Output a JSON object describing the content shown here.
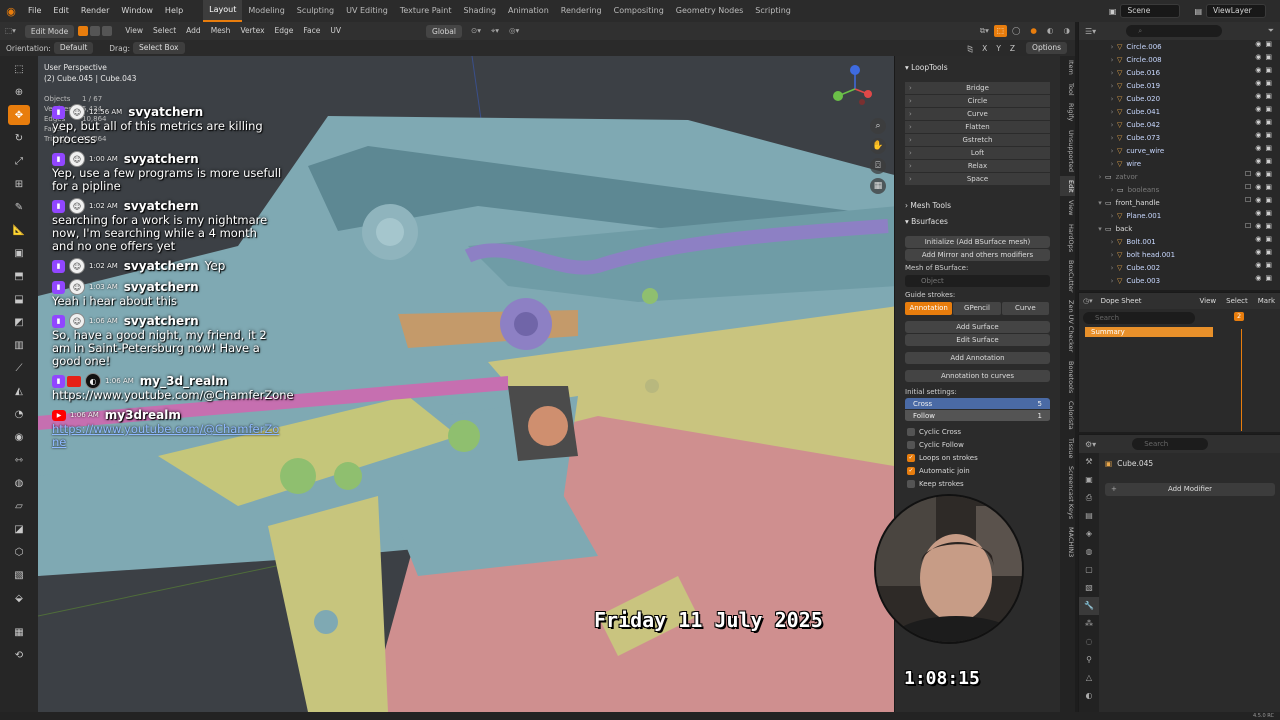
{
  "menu": [
    "File",
    "Edit",
    "Render",
    "Window",
    "Help"
  ],
  "workspaces": [
    "Layout",
    "Modeling",
    "Sculpting",
    "UV Editing",
    "Texture Paint",
    "Shading",
    "Animation",
    "Rendering",
    "Compositing",
    "Geometry Nodes",
    "Scripting"
  ],
  "active_workspace": "Layout",
  "scene_name": "Scene",
  "view_layer": "ViewLayer",
  "header": {
    "mode": "Edit Mode",
    "menus": [
      "View",
      "Select",
      "Add",
      "Mesh",
      "Vertex",
      "Edge",
      "Face",
      "UV"
    ],
    "transform": "Global",
    "options": "Options",
    "xyz": [
      "X",
      "Y",
      "Z"
    ]
  },
  "header3": {
    "orientation_label": "Orientation:",
    "orientation_value": "Default",
    "drag_label": "Drag:",
    "drag_value": "Select Box"
  },
  "viewport": {
    "view_name": "User Perspective",
    "object_name": "(2) Cube.045 | Cube.043",
    "stats": [
      {
        "label": "Objects",
        "value": "1 / 67"
      },
      {
        "label": "Vertices",
        "value": "5,434"
      },
      {
        "label": "Edges",
        "value": "10,864"
      },
      {
        "label": "Faces",
        "value": ""
      },
      {
        "label": "Triangles",
        "value": "10,864"
      }
    ]
  },
  "chat": [
    {
      "badge": "twitch",
      "time": "12:56 AM",
      "user": "svyatchern",
      "inline": "",
      "text": "yep, but all of this metrics are killing process"
    },
    {
      "badge": "twitch",
      "time": "1:00 AM",
      "user": "svyatchern",
      "inline": "",
      "text": "Yep, use a few programs is more usefull for a pipline"
    },
    {
      "badge": "twitch",
      "time": "1:02 AM",
      "user": "svyatchern",
      "inline": "",
      "text": "searching for a work is my nightmare now, I'm searching while a 4 month and no one offers yet"
    },
    {
      "badge": "twitch",
      "time": "1:02 AM",
      "user": "svyatchern",
      "inline": "Yep",
      "text": ""
    },
    {
      "badge": "twitch",
      "time": "1:03 AM",
      "user": "svyatchern",
      "inline": "",
      "text": "Yeah i hear about this"
    },
    {
      "badge": "twitch",
      "time": "1:06 AM",
      "user": "svyatchern",
      "inline": "",
      "text": "So, have a good night, my friend, it 2 am in Saint-Petersburg now! Have a good one!"
    },
    {
      "badge": "twitch",
      "time": "1:06 AM",
      "user": "my_3d_realm",
      "inline": "",
      "text": "https://www.youtube.com/@ChamferZone"
    },
    {
      "badge": "youtube",
      "time": "1:06 AM",
      "user": "my3drealm",
      "inline": "",
      "link": "https://www.youtube.com/@ChamferZone"
    }
  ],
  "overlay": {
    "date": "Friday 11 July 2025",
    "timer": "1:08:15"
  },
  "npanel": {
    "looptools_title": "LoopTools",
    "looptools": [
      "Bridge",
      "Circle",
      "Curve",
      "Flatten",
      "Gstretch",
      "Loft",
      "Relax",
      "Space"
    ],
    "mesh_tools": "Mesh Tools",
    "bsurfaces": "Bsurfaces",
    "init_btn": "Initialize (Add BSurface mesh)",
    "mirror_btn": "Add Mirror and others modifiers",
    "mesh_label": "Mesh of BSurface:",
    "mesh_field": "Object",
    "guide_label": "Guide strokes:",
    "guide_tabs": [
      "Annotation",
      "GPencil",
      "Curve"
    ],
    "add_surface": "Add Surface",
    "edit_surface": "Edit Surface",
    "add_annotation": "Add Annotation",
    "annotation_curves": "Annotation to curves",
    "initial_label": "Initial settings:",
    "cross_label": "Cross",
    "cross_value": "5",
    "follow_label": "Follow",
    "follow_value": "1",
    "checks": [
      {
        "label": "Cyclic Cross",
        "on": false
      },
      {
        "label": "Cyclic Follow",
        "on": false
      },
      {
        "label": "Loops on strokes",
        "on": true
      },
      {
        "label": "Automatic join",
        "on": true
      },
      {
        "label": "Keep strokes",
        "on": false
      }
    ]
  },
  "vtabs": [
    "Item",
    "Tool",
    "Rigify",
    "Unsupported",
    "Edit",
    "View",
    "HardOps",
    "BoxCutter",
    "Zen UV Checker",
    "Bonetools",
    "Colorista",
    "Tissue",
    "Screencast Keys",
    "MACHIN3"
  ],
  "outliner": {
    "rows": [
      {
        "name": "Circle.006",
        "type": "obj",
        "indent": 2
      },
      {
        "name": "Circle.008",
        "type": "obj",
        "indent": 2
      },
      {
        "name": "Cube.016",
        "type": "obj",
        "indent": 2
      },
      {
        "name": "Cube.019",
        "type": "obj",
        "indent": 2
      },
      {
        "name": "Cube.020",
        "type": "obj",
        "indent": 2
      },
      {
        "name": "Cube.041",
        "type": "obj",
        "indent": 2
      },
      {
        "name": "Cube.042",
        "type": "obj",
        "indent": 2
      },
      {
        "name": "Cube.073",
        "type": "obj",
        "indent": 2
      },
      {
        "name": "curve_wire",
        "type": "obj",
        "indent": 2
      },
      {
        "name": "wire",
        "type": "obj",
        "indent": 2
      },
      {
        "name": "zatvor",
        "type": "dim",
        "indent": 1
      },
      {
        "name": "booleans",
        "type": "dim",
        "indent": 2
      },
      {
        "name": "front_handle",
        "type": "coll",
        "indent": 1
      },
      {
        "name": "Plane.001",
        "type": "obj",
        "indent": 2
      },
      {
        "name": "back",
        "type": "coll",
        "indent": 1
      },
      {
        "name": "Bolt.001",
        "type": "obj",
        "indent": 2
      },
      {
        "name": "bolt head.001",
        "type": "obj",
        "indent": 2
      },
      {
        "name": "Cube.002",
        "type": "obj",
        "indent": 2
      },
      {
        "name": "Cube.003",
        "type": "obj",
        "indent": 2
      }
    ]
  },
  "dopesheet": {
    "mode": "Dope Sheet",
    "menus": [
      "View",
      "Select",
      "Mark"
    ],
    "search": "Search",
    "summary": "Summary",
    "frame": "2"
  },
  "properties": {
    "search": "Search",
    "object": "Cube.045",
    "add_modifier": "Add Modifier"
  },
  "version": "4.5.0 RC"
}
